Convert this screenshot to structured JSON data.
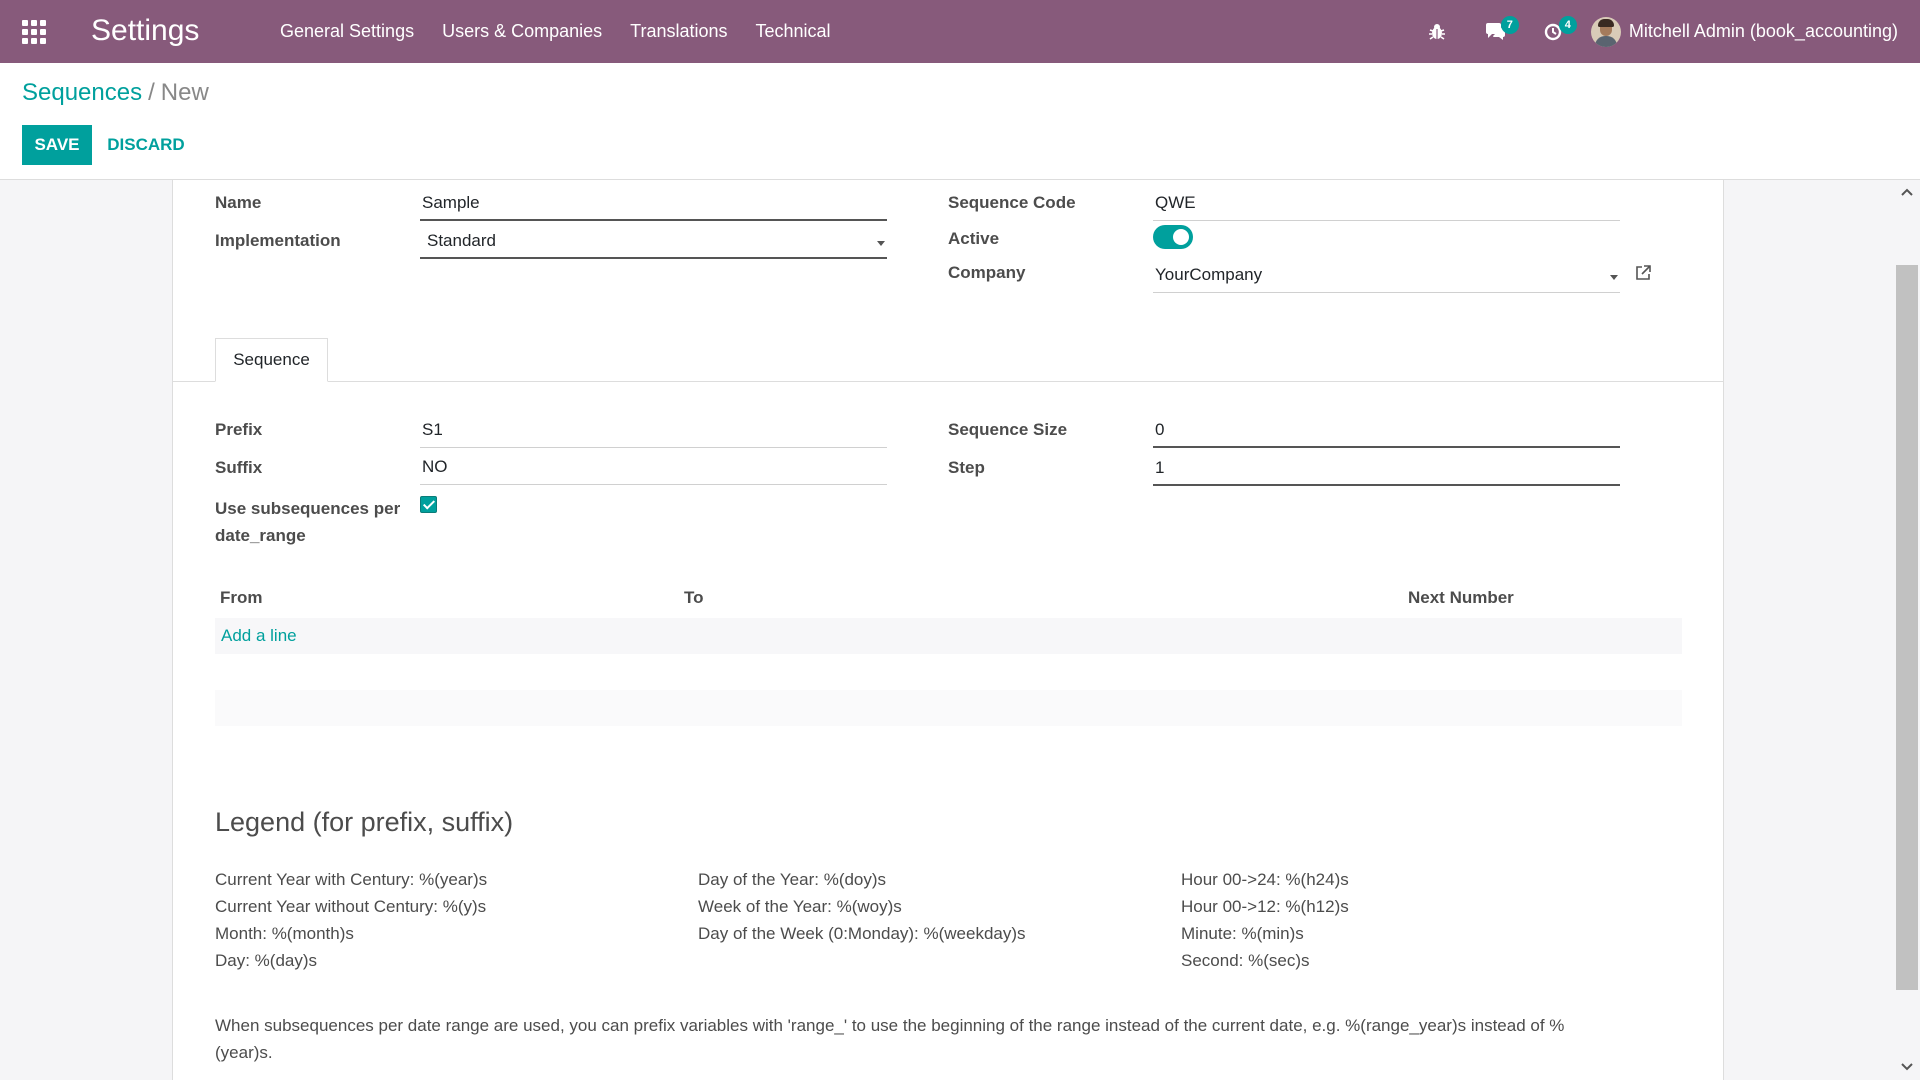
{
  "navbar": {
    "app_title": "Settings",
    "menu": [
      "General Settings",
      "Users & Companies",
      "Translations",
      "Technical"
    ],
    "messages_count": "7",
    "activities_count": "4",
    "user_name": "Mitchell Admin (book_accounting)"
  },
  "breadcrumb": {
    "parent": "Sequences",
    "separator": "/",
    "current": "New"
  },
  "buttons": {
    "save": "SAVE",
    "discard": "DISCARD"
  },
  "form": {
    "name_label": "Name",
    "name_value": "Sample",
    "implementation_label": "Implementation",
    "implementation_value": "Standard",
    "code_label": "Sequence Code",
    "code_value": "QWE",
    "active_label": "Active",
    "company_label": "Company",
    "company_value": "YourCompany"
  },
  "tabs": {
    "sequence": "Sequence"
  },
  "sequence_tab": {
    "prefix_label": "Prefix",
    "prefix_value": "S1",
    "suffix_label": "Suffix",
    "suffix_value": "NO",
    "subseq_label_1": "Use subsequences per",
    "subseq_label_2": "date_range",
    "size_label": "Sequence Size",
    "size_value": "0",
    "step_label": "Step",
    "step_value": "1"
  },
  "range_table": {
    "columns": [
      "From",
      "To",
      "Next Number"
    ],
    "add_line": "Add a line"
  },
  "legend": {
    "title": "Legend (for prefix, suffix)",
    "col1": [
      "Current Year with Century: %(year)s",
      "Current Year without Century: %(y)s",
      "Month: %(month)s",
      "Day: %(day)s"
    ],
    "col2": [
      "Day of the Year: %(doy)s",
      "Week of the Year: %(woy)s",
      "Day of the Week (0:Monday): %(weekday)s"
    ],
    "col3": [
      "Hour 00->24: %(h24)s",
      "Hour 00->12: %(h12)s",
      "Minute: %(min)s",
      "Second: %(sec)s"
    ],
    "note": "When subsequences per date range are used, you can prefix variables with 'range_' to use the beginning of the range instead of the current date, e.g. %(range_year)s instead of %(year)s."
  }
}
